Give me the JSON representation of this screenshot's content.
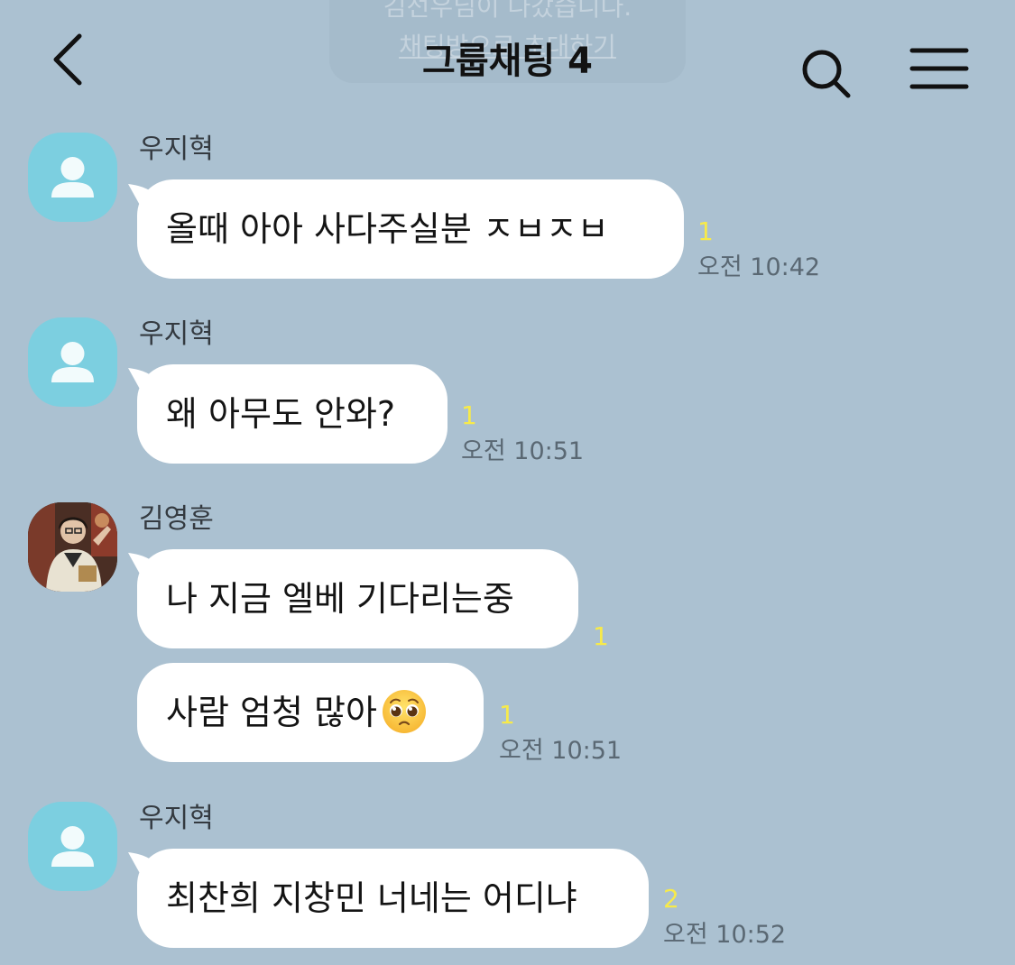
{
  "header": {
    "title": "그룹채팅 4",
    "ghost_notice_line1": "김선우님이 나갔습니다.",
    "ghost_notice_line2": "채팅방으로 초대하기"
  },
  "messages": [
    {
      "sender": "우지혁",
      "avatar": "default-profile-icon",
      "bubbles": [
        {
          "text": "올때 아아 사다주실분 ㅈㅂㅈㅂ",
          "unread": "1",
          "time": "오전 10:42"
        }
      ]
    },
    {
      "sender": "우지혁",
      "avatar": "default-profile-icon",
      "bubbles": [
        {
          "text": "왜 아무도 안와?",
          "unread": "1",
          "time": "오전 10:51"
        }
      ]
    },
    {
      "sender": "김영훈",
      "avatar": "profile-photo",
      "bubbles": [
        {
          "text": "나 지금 엘베 기다리는중",
          "unread": "1",
          "time": ""
        },
        {
          "text": "사람 엄청 많아",
          "emoji": "pleading-face-emoji",
          "unread": "1",
          "time": "오전 10:51"
        }
      ]
    },
    {
      "sender": "우지혁",
      "avatar": "default-profile-icon",
      "bubbles": [
        {
          "text": "최찬희 지창민 너네는 어디냐",
          "unread": "2",
          "time": "오전 10:52"
        }
      ]
    }
  ],
  "colors": {
    "background": "#abc1d1",
    "bubble": "#ffffff",
    "unread": "#f7ea4a",
    "default_avatar": "#7ccfe0"
  }
}
